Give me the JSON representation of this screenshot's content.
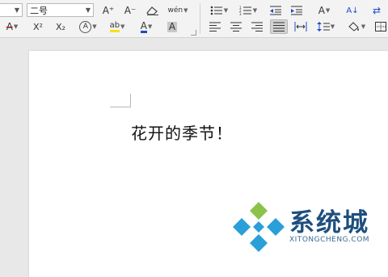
{
  "ribbon": {
    "font_size_value": "二号",
    "font_name_value": "",
    "buttons_row1": {
      "grow_font": "A⁺",
      "shrink_font": "A⁻",
      "clear_format": "⌫",
      "phonetic": "wén",
      "bullets": "☰",
      "numbering": "☰",
      "decrease_indent": "⇤",
      "increase_indent": "⇥",
      "text_effects": "A",
      "sort": "A↓",
      "show_marks": "⇄"
    },
    "buttons_row2": {
      "strikethrough": "A",
      "superscript": "X²",
      "subscript": "X₂",
      "char_border": "A",
      "highlight": "ab",
      "font_color": "A",
      "char_shading": "A",
      "align_left": "≡",
      "align_center": "≡",
      "align_right": "≡",
      "justify": "≡",
      "distributed": "⇔",
      "line_spacing": "↕",
      "shading": "◇",
      "borders": "⊞"
    },
    "colors": {
      "strike_color": "#c00000",
      "highlight_color": "#ffe000",
      "font_color": "#1f49c7"
    }
  },
  "document": {
    "body_text": "花开的季节！"
  },
  "watermark": {
    "name": "系统城",
    "url": "XITONGCHENG.COM",
    "colors": {
      "blue": "#2a9fd8",
      "green": "#8bc34a",
      "text": "#1e4f7e"
    }
  }
}
